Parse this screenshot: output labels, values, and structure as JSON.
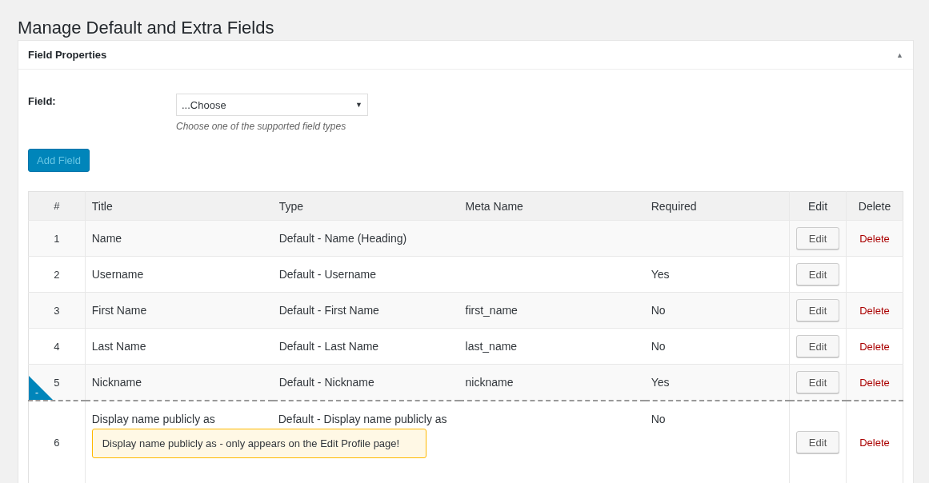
{
  "page_title": "Manage Default and Extra Fields",
  "panel": {
    "title": "Field Properties",
    "collapse_icon": "▲",
    "field_label": "Field:",
    "select_value": "...Choose",
    "select_arrow": "▼",
    "hint": "Choose one of the supported field types",
    "add_button": "Add Field"
  },
  "table": {
    "columns": [
      "#",
      "Title",
      "Type",
      "Meta Name",
      "Required",
      "Edit",
      "Delete"
    ],
    "rows": [
      {
        "number": "1",
        "title": "Name",
        "type": "Default - Name (Heading)",
        "meta_name": "",
        "required": "",
        "edit": "Edit",
        "delete": "Delete"
      },
      {
        "number": "2",
        "title": "Username",
        "type": "Default - Username",
        "meta_name": "",
        "required": "Yes",
        "edit": "Edit",
        "delete": ""
      },
      {
        "number": "3",
        "title": "First Name",
        "type": "Default - First Name",
        "meta_name": "first_name",
        "required": "No",
        "edit": "Edit",
        "delete": "Delete"
      },
      {
        "number": "4",
        "title": "Last Name",
        "type": "Default - Last Name",
        "meta_name": "last_name",
        "required": "No",
        "edit": "Edit",
        "delete": "Delete"
      },
      {
        "number": "5",
        "title": "Nickname",
        "type": "Default - Nickname",
        "meta_name": "nickname",
        "required": "Yes",
        "edit": "Edit",
        "delete": "Delete",
        "marker": "-"
      },
      {
        "number": "6",
        "title": "Display name publicly as",
        "type": "Default - Display name publicly as",
        "meta_name": "",
        "required": "No",
        "edit": "Edit",
        "delete": "Delete",
        "note": "Display name publicly as - only appears on the Edit Profile page!"
      }
    ]
  }
}
